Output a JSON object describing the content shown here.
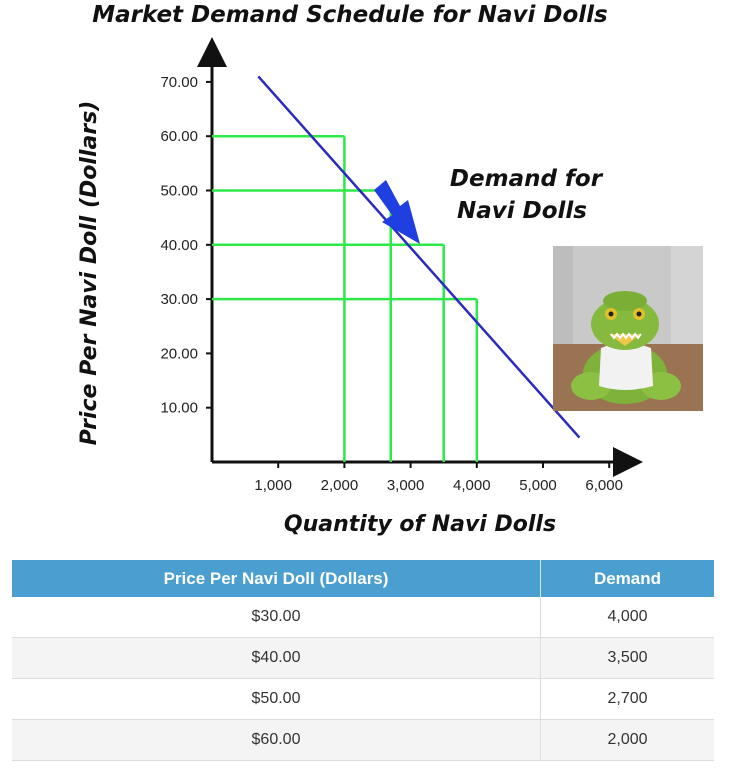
{
  "chart_data": {
    "type": "line",
    "title": "Market Demand Schedule for Navi Dolls",
    "xlabel": "Quantity of Navi Dolls",
    "ylabel": "Price Per Navi Doll (Dollars)",
    "xlim": [
      0,
      6200
    ],
    "ylim": [
      0,
      76
    ],
    "x_ticks": [
      "1,000",
      "2,000",
      "3,000",
      "4,000",
      "5,000",
      "6,000"
    ],
    "x_tick_values": [
      1000,
      2000,
      3000,
      4000,
      5000,
      6000
    ],
    "y_ticks": [
      "10.00",
      "20.00",
      "30.00",
      "40.00",
      "50.00",
      "60.00",
      "70.00"
    ],
    "y_tick_values": [
      10,
      20,
      30,
      40,
      50,
      60,
      70
    ],
    "series": [
      {
        "name": "Demand for Navi Dolls",
        "color": "#2b2bbd",
        "x": [
          700,
          5550
        ],
        "y": [
          71,
          4.5
        ]
      }
    ],
    "guides": [
      {
        "x": 2000,
        "y": 60,
        "color": "#2ee84a"
      },
      {
        "x": 2700,
        "y": 50,
        "color": "#2ee84a"
      },
      {
        "x": 3500,
        "y": 40,
        "color": "#2ee84a"
      },
      {
        "x": 4000,
        "y": 30,
        "color": "#2ee84a"
      }
    ],
    "annotation": {
      "lines": [
        "Demand for",
        "Navi Dolls"
      ],
      "arrow_color": "#1f3fe0"
    },
    "grid": false,
    "legend": "none"
  },
  "photo": {
    "subject": "plush green crocodile doll",
    "icon": "doll-photo"
  },
  "table": {
    "header_color": "#4a9fd0",
    "headers": [
      "Price Per Navi Doll (Dollars)",
      "Demand"
    ],
    "rows": [
      [
        "$30.00",
        "4,000"
      ],
      [
        "$40.00",
        "3,500"
      ],
      [
        "$50.00",
        "2,700"
      ],
      [
        "$60.00",
        "2,000"
      ]
    ]
  }
}
